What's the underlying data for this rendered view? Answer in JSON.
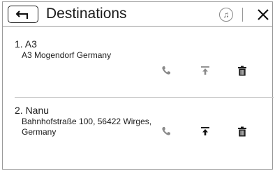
{
  "header": {
    "title": "Destinations",
    "back_icon": "back-arrow-icon",
    "music_icon": "music-note-icon",
    "close_icon": "close-icon"
  },
  "destinations": [
    {
      "name": "1. A3",
      "address": "A3 Mogendorf Germany",
      "state": "second-row"
    },
    {
      "name": "2. Nanu",
      "address": "Bahnhofstraße 100, 56422 Wirges, Germany",
      "state": "first-row"
    }
  ],
  "colors": {
    "icon_active": "#1a1a1a",
    "icon_dim": "#8a8a8a",
    "border": "#9a9a9a"
  }
}
